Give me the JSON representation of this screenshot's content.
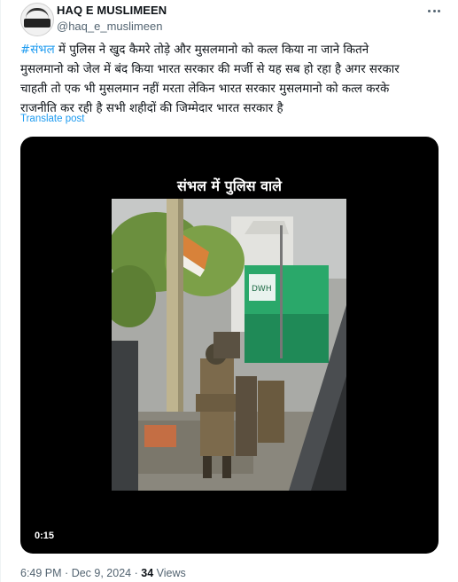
{
  "author": {
    "name": "HAQ E MUSLIMEEN",
    "handle": "@haq_e_muslimeen"
  },
  "post": {
    "hashtag": "#संभल",
    "lines": [
      " में पुलिस ने खुद कैमरे तोड़े और मुसलमानो को कत्ल किया ना जाने कितने",
      "मुसलमानो को जेल में बंद किया भारत सरकार की मर्जी से यह सब हो रहा है अगर सरकार",
      "चाहती तो एक भी मुसलमान नहीं मरता लेकिन भारत सरकार मुसलमानो को कत्ल करके",
      "राजनीति कर रही है सभी शहीदों की जिम्मेदार भारत सरकार है"
    ],
    "translate_label": "Translate post"
  },
  "media": {
    "caption": "संभल में पुलिस वाले",
    "duration": "0:15"
  },
  "meta": {
    "time": "6:49 PM",
    "separator": "·",
    "date": "Dec 9, 2024",
    "views_count": "34",
    "views_label": "Views"
  },
  "icons": {
    "more": "more-horizontal-icon",
    "avatar": "circular-logo"
  },
  "colors": {
    "accent": "#1d9bf0",
    "secondary_text": "#536471",
    "video_background": "#000000"
  }
}
